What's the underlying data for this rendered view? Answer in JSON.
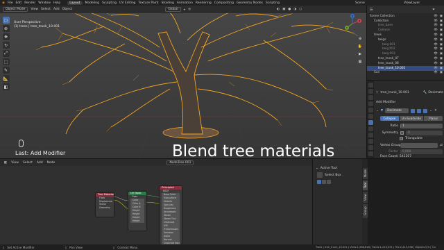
{
  "menubar": {
    "menus": [
      "File",
      "Edit",
      "Render",
      "Window",
      "Help"
    ],
    "workspaces": [
      "Layout",
      "Modeling",
      "Sculpting",
      "UV Editing",
      "Texture Paint",
      "Shading",
      "Animation",
      "Rendering",
      "Compositing",
      "Geometry Nodes",
      "Scripting"
    ],
    "active_workspace": "Layout",
    "scene_label": "Scene",
    "viewlayer_label": "ViewLayer"
  },
  "viewport": {
    "mode": "Object Mode",
    "menus": [
      "View",
      "Select",
      "Add",
      "Object"
    ],
    "orientation": "Global",
    "perspective": "User Perspective",
    "object_info": "(1) trees | tree_trunk_10.001",
    "last_operation": "Last: Add Modifier",
    "overlay_caption": "Blend tree materials",
    "gizmo_axes": [
      "X",
      "Y",
      "Z"
    ]
  },
  "outliner": {
    "search_placeholder": "",
    "items": [
      {
        "label": "Scene Collection",
        "indent": 0,
        "selected": false,
        "dim": false
      },
      {
        "label": "Collection",
        "indent": 1,
        "selected": false,
        "dim": false
      },
      {
        "label": "tree_base",
        "indent": 2,
        "selected": false,
        "dim": true
      },
      {
        "label": "Camera",
        "indent": 2,
        "selected": false,
        "dim": true
      },
      {
        "label": "trees",
        "indent": 1,
        "selected": false,
        "dim": false
      },
      {
        "label": "twigs",
        "indent": 2,
        "selected": false,
        "dim": false
      },
      {
        "label": "twig.001",
        "indent": 3,
        "selected": false,
        "dim": true
      },
      {
        "label": "twig.002",
        "indent": 3,
        "selected": false,
        "dim": true
      },
      {
        "label": "twig.003",
        "indent": 3,
        "selected": false,
        "dim": true
      },
      {
        "label": "tree_trunk_07",
        "indent": 2,
        "selected": false,
        "dim": false
      },
      {
        "label": "tree_trunk_08",
        "indent": 2,
        "selected": false,
        "dim": false
      },
      {
        "label": "tree_trunk_10.001",
        "indent": 2,
        "selected": true,
        "dim": false
      },
      {
        "label": "Sun",
        "indent": 1,
        "selected": false,
        "dim": false
      }
    ]
  },
  "properties": {
    "object_name": "tree_trunk_10.001",
    "modifier_type": "Decimate",
    "add_modifier": "Add Modifier",
    "modifier_name": "Decimate",
    "modes": [
      "Collapse",
      "Un-Subdivide",
      "Planar"
    ],
    "active_mode": "Collapse",
    "ratio_label": "Ratio",
    "ratio_value": "1",
    "ratio": 0.02,
    "symmetry_label": "Symmetry",
    "symmetry_axis": "X",
    "triangulate_label": "Triangulate",
    "vertex_group_label": "Vertex Group",
    "factor_label": "Factor",
    "factor_value": "0.000",
    "face_count": "Face Count: 541207"
  },
  "node_editor": {
    "menus": [
      "View",
      "Select",
      "Add",
      "Node"
    ],
    "tree_name": "NodeTree.001",
    "nodes": [
      {
        "title": "Tree Material",
        "rows": [
          "Float",
          "Displacement Base",
          "Vector",
          "Geometry"
        ],
        "color": "#8a2f3e"
      },
      {
        "title": "UV Node",
        "rows": [
          "Float",
          "Color",
          "Color A",
          "Color B",
          "Height",
          "Height",
          "Height",
          "Height"
        ],
        "color": "#2f7a4a"
      },
      {
        "title": "Principled",
        "rows": [
          "BSDF",
          "Base Color",
          "Subsurface",
          "Metallic",
          "Specular",
          "Roughness",
          "Anisotropic",
          "Sheen",
          "Sheen Tint",
          "Clearcoat",
          "IOR",
          "Transmission",
          "Emission",
          "Alpha",
          "Normal",
          "Clearcoat Normal",
          "Tangent",
          "Weight"
        ],
        "color": "#8a2f3e"
      }
    ]
  },
  "ne_sidebar": {
    "title": "Active Tool",
    "tool": "Select Box",
    "tabs": [
      "Node",
      "Tool",
      "View",
      "Group"
    ],
    "active_tab": "Tool"
  },
  "statusbar": {
    "items": [
      "Set Active Modifier",
      "Pan View",
      "Context Menu"
    ],
    "stats": "Trees | tree_trunk_10.001 | Verts:1,586,818 | Faces:1,213,351 | Tris:2,213,938 | Objects:0/4 | 3.x"
  },
  "colors": {
    "accent": "#4772b3",
    "selection_orange": "#f5a623",
    "node_red": "#8a2f3e",
    "node_green": "#2f7a4a"
  }
}
